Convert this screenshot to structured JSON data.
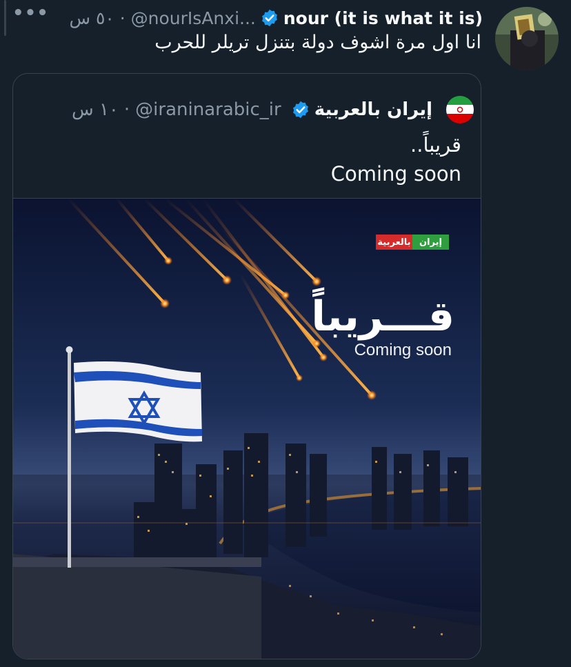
{
  "tweet": {
    "display_name": "nour (it is what it is)",
    "handle": "@nourIsAnxi...",
    "time": "٥٠ س",
    "text": "انا اول مرة اشوف دولة بتنزل تريلر للحرب",
    "more_icon": "more-horizontal-icon"
  },
  "quote": {
    "display_name": "إيران بالعربية",
    "handle": "@iraninarabic_ir",
    "time": "١٠ س",
    "text_line1": "قريباً..",
    "text_line2": "Coming soon",
    "media": {
      "badge_left": "إيران",
      "badge_right": "بالعربية",
      "headline_ar": "قـــريباً",
      "headline_en": "Coming soon"
    }
  },
  "colors": {
    "background": "#15202b",
    "verified": "#1d9bf0",
    "muted": "#8b98a5",
    "border": "#38444d"
  }
}
